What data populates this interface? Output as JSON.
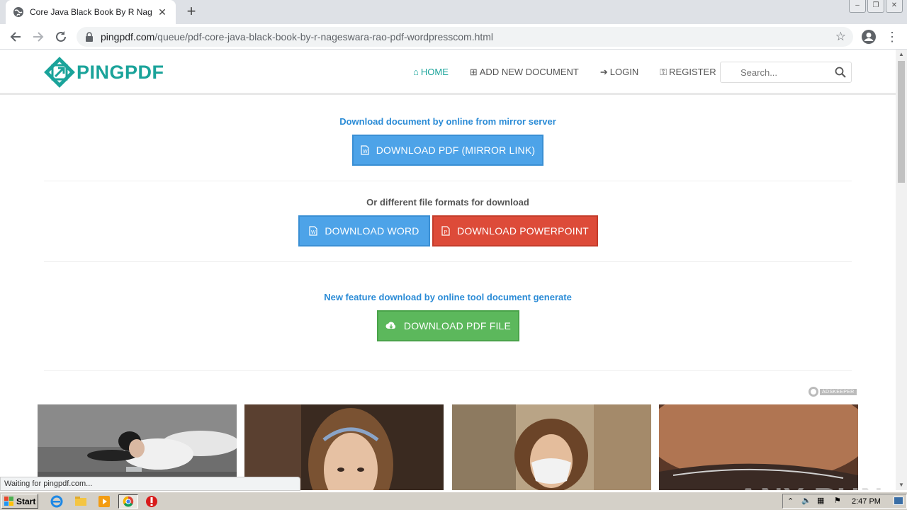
{
  "browser": {
    "tab_title": "Core Java Black Book By R Nageswa",
    "url_domain": "pingpdf.com",
    "url_path": "/queue/pdf-core-java-black-book-by-r-nageswara-rao-pdf-wordpresscom.html"
  },
  "site": {
    "logo_text": "PINGPDF",
    "nav": {
      "home": "HOME",
      "add": "ADD NEW DOCUMENT",
      "login": "LOGIN",
      "register": "REGISTER"
    },
    "search_placeholder": "Search..."
  },
  "main": {
    "mirror_heading": "Download document by online from mirror server",
    "mirror_button": "DOWNLOAD PDF (MIRROR LINK)",
    "formats_heading": "Or different file formats for download",
    "word_button": "DOWNLOAD WORD",
    "ppt_button": "DOWNLOAD POWERPOINT",
    "tool_heading": "New feature download by online tool document generate",
    "pdf_button": "DOWNLOAD PDF FILE"
  },
  "ads": {
    "label": "ADSKEEPER"
  },
  "status_text": "Waiting for pingpdf.com...",
  "watermark": "ANY RUN",
  "taskbar": {
    "start_label": "Start",
    "clock": "2:47 PM"
  },
  "colors": {
    "brand": "#1aa39a",
    "blue_button": "#4da3e8",
    "red_button": "#dd4b39",
    "green_button": "#5cb85c"
  }
}
